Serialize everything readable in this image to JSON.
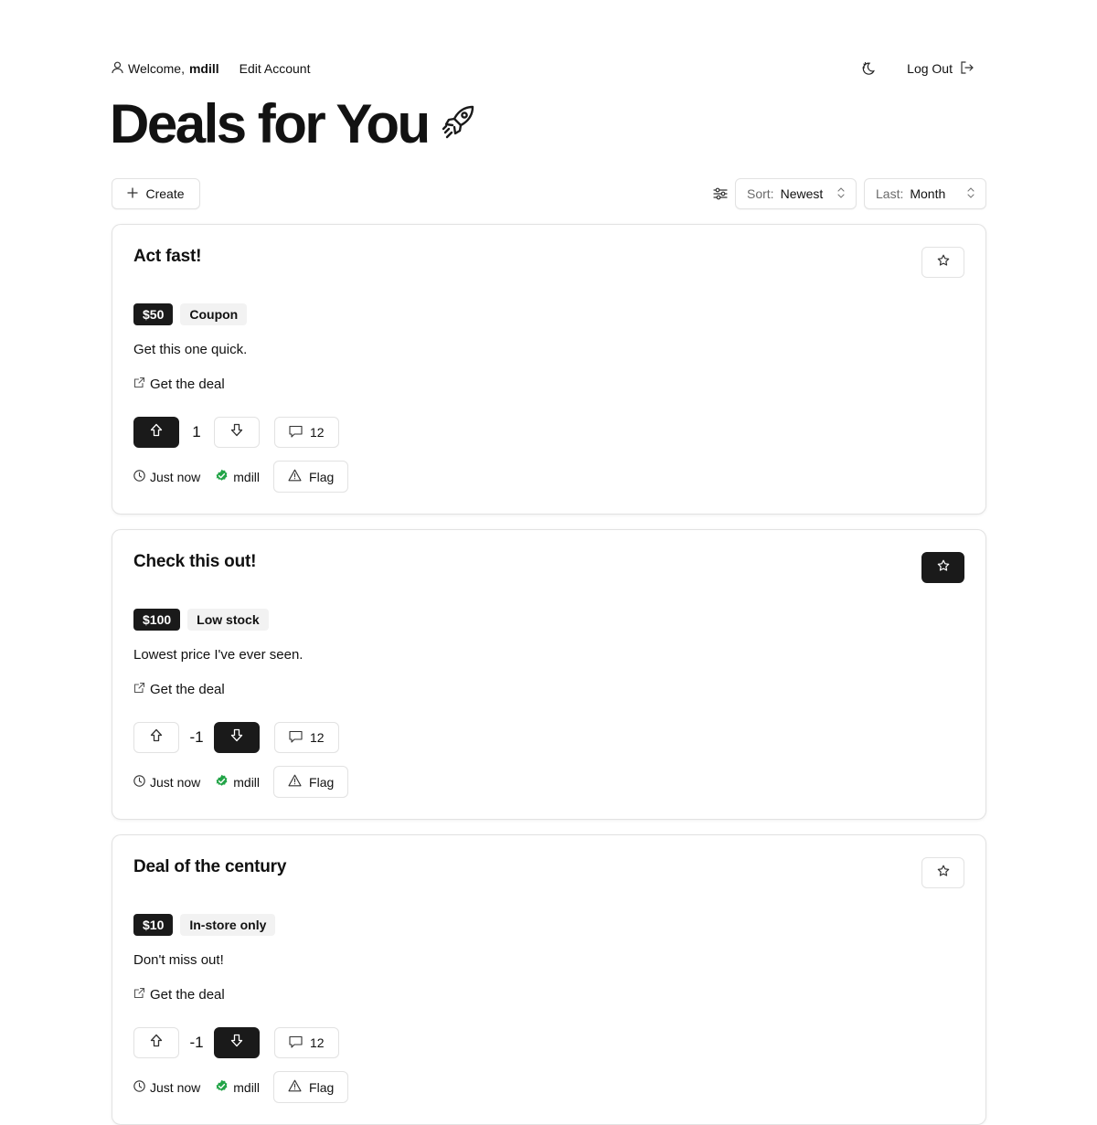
{
  "header": {
    "welcome_prefix": "Welcome,",
    "username": "mdill",
    "edit_account": "Edit Account",
    "logout": "Log Out"
  },
  "page": {
    "title": "Deals for You"
  },
  "toolbar": {
    "create_label": "Create",
    "sort_label": "Sort:",
    "sort_value": "Newest",
    "last_label": "Last:",
    "last_value": "Month"
  },
  "deals": [
    {
      "title": "Act fast!",
      "price": "$50",
      "tag": "Coupon",
      "description": "Get this one quick.",
      "link_label": "Get the deal",
      "score": "1",
      "upvoted": true,
      "downvoted": false,
      "comments": "12",
      "time": "Just now",
      "author": "mdill",
      "flag_label": "Flag",
      "starred": false
    },
    {
      "title": "Check this out!",
      "price": "$100",
      "tag": "Low stock",
      "description": "Lowest price I've ever seen.",
      "link_label": "Get the deal",
      "score": "-1",
      "upvoted": false,
      "downvoted": true,
      "comments": "12",
      "time": "Just now",
      "author": "mdill",
      "flag_label": "Flag",
      "starred": true
    },
    {
      "title": "Deal of the century",
      "price": "$10",
      "tag": "In-store only",
      "description": "Don't miss out!",
      "link_label": "Get the deal",
      "score": "-1",
      "upvoted": false,
      "downvoted": true,
      "comments": "12",
      "time": "Just now",
      "author": "mdill",
      "flag_label": "Flag",
      "starred": false
    }
  ],
  "colors": {
    "dark": "#1a1a1a",
    "border": "#e2e2e2",
    "verified": "#22a447",
    "muted": "#6b6b6b"
  },
  "icons": [
    "user-icon",
    "theme-toggle-icon",
    "logout-icon",
    "rocket-icon",
    "plus-icon",
    "filter-icon",
    "chevron-updown-icon",
    "star-icon",
    "external-link-icon",
    "arrow-up-icon",
    "arrow-down-icon",
    "comment-icon",
    "clock-icon",
    "verified-icon",
    "warning-icon"
  ]
}
